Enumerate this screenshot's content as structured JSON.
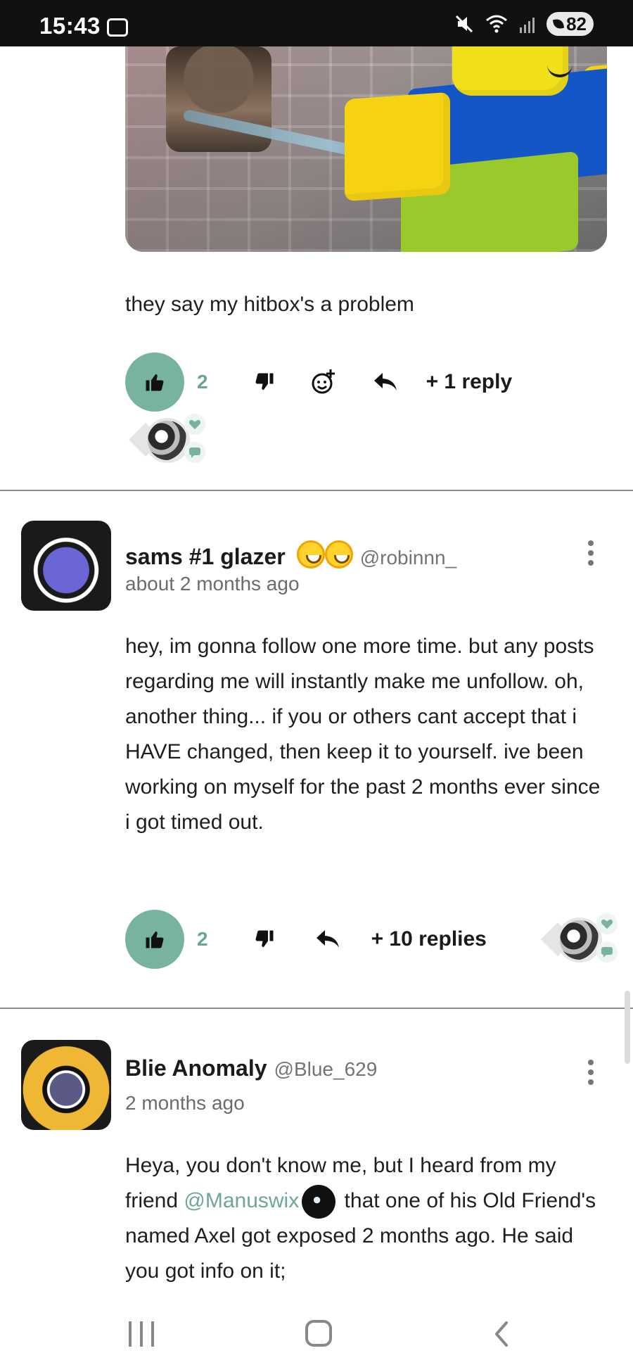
{
  "status_bar": {
    "time": "15:43",
    "battery": "82",
    "icons": [
      "screenshot-icon",
      "mute-icon",
      "wifi-icon",
      "signal-icon",
      "battery-icon"
    ]
  },
  "post": {
    "image_alt": "",
    "caption": "they say my hitbox's a problem",
    "actions": {
      "likes": "2",
      "reply_link": "+ 1 reply"
    }
  },
  "comments": [
    {
      "author": "sams #1 glazer",
      "handle": "@robinnn_",
      "time": "about 2 months ago",
      "text": "hey, im gonna follow one more time. but any posts regarding me will instantly make me unfollow. oh, another thing... if you or others cant accept that i HAVE changed, then keep it to yourself. ive been working on myself for the past 2 months ever since i got timed out.",
      "likes": "2",
      "reply_link": "+ 10 replies"
    },
    {
      "author": "Blie Anomaly",
      "handle": "@Blue_629",
      "time": "2 months ago",
      "text_before_mention": "Heya, you don't know me, but I heard from my friend ",
      "mention": "@Manuswix",
      "text_after_mention": " that one of his Old Friend's named Axel got exposed 2 months ago. He said you got info on it;"
    }
  ],
  "colors": {
    "accent": "#78b39d",
    "mention": "#6ea894",
    "divider": "#8a8a8a",
    "status_bar": "#111111"
  }
}
